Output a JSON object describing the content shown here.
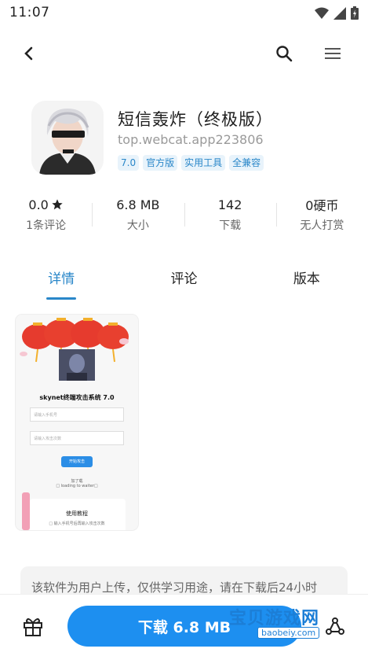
{
  "status_bar": {
    "time": "11:07"
  },
  "app": {
    "name": "短信轰炸（终极版）",
    "package": "top.webcat.app223806",
    "tags": [
      "7.0",
      "官方版",
      "实用工具",
      "全兼容"
    ]
  },
  "stats": [
    {
      "value": "0.0",
      "label": "1条评论",
      "has_star": true
    },
    {
      "value": "6.8 MB",
      "label": "大小"
    },
    {
      "value": "142",
      "label": "下载"
    },
    {
      "value": "0硬币",
      "label": "无人打赏"
    }
  ],
  "tabs": [
    "详情",
    "评论",
    "版本"
  ],
  "active_tab": 0,
  "screenshot": {
    "title": "skynet终端攻击系统 7.0",
    "phone_placeholder": "请输入手机号",
    "count_placeholder": "请输入攻击次数",
    "start_button": "开始攻击",
    "loading_prefix": "加了载",
    "loading_text": "□ loading to waiter□",
    "card_title": "使用教程",
    "card_text": "□ 输入手机号后再输入攻击次数"
  },
  "notice": "该软件为用户上传，仅供学习用途，请在下载后24小时",
  "download_button": "下载 6.8 MB",
  "watermark": {
    "text": "宝贝游戏网",
    "url": "baobeiy.com"
  },
  "colors": {
    "accent": "#2a87c9",
    "button": "#1d8ff0",
    "tag_bg": "#e8f3fb"
  }
}
